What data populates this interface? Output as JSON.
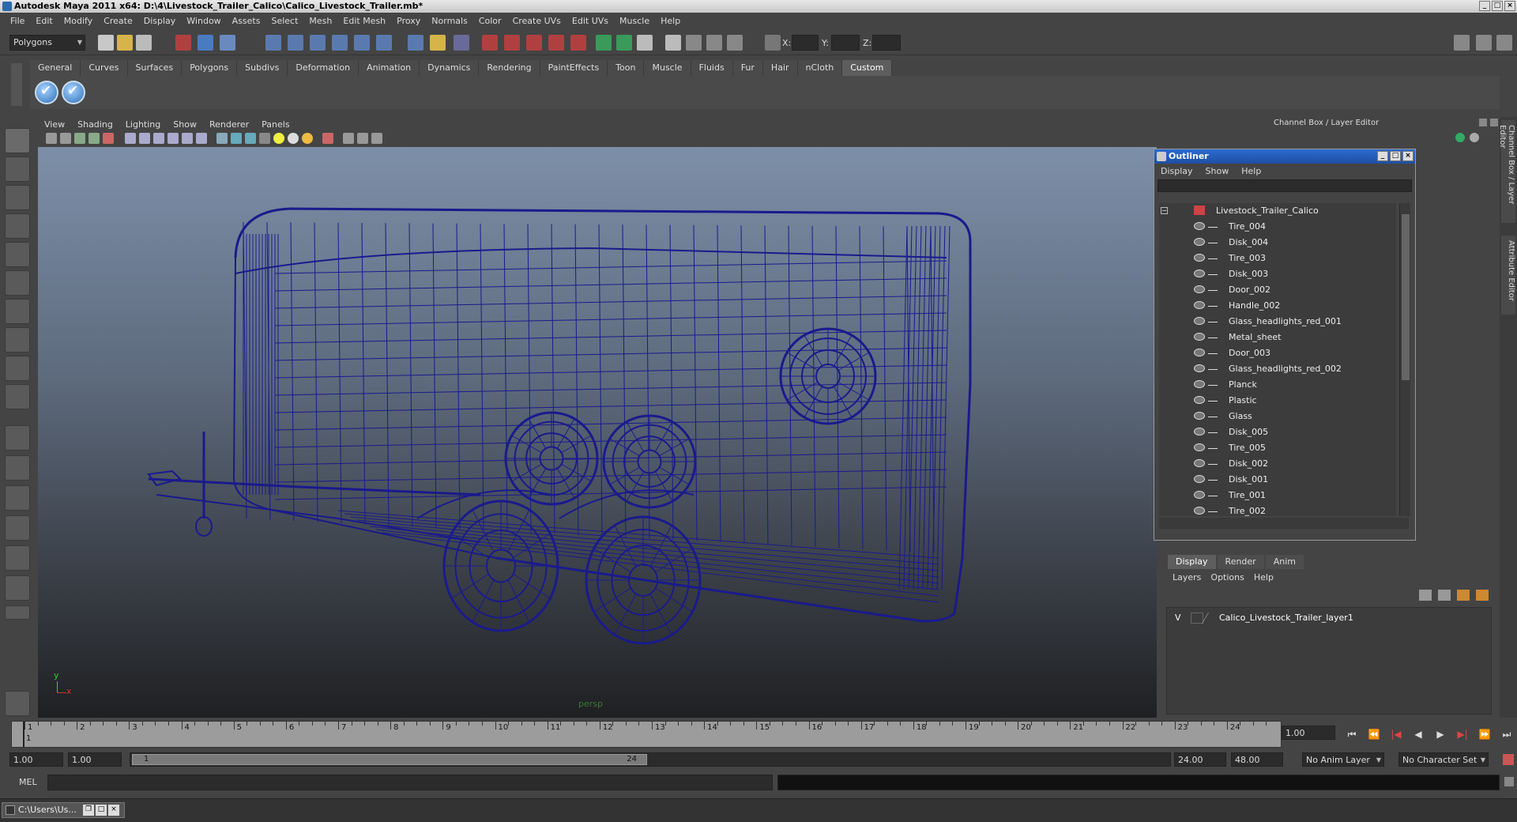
{
  "title": "Autodesk Maya 2011 x64: D:\\4\\Livestock_Trailer_Calico\\Calico_Livestock_Trailer.mb*",
  "menus": [
    "File",
    "Edit",
    "Modify",
    "Create",
    "Display",
    "Window",
    "Assets",
    "Select",
    "Mesh",
    "Edit Mesh",
    "Proxy",
    "Normals",
    "Color",
    "Create UVs",
    "Edit UVs",
    "Muscle",
    "Help"
  ],
  "status": {
    "mode": "Polygons",
    "x_label": "X:",
    "y_label": "Y:",
    "z_label": "Z:"
  },
  "shelf_tabs": [
    "General",
    "Curves",
    "Surfaces",
    "Polygons",
    "Subdivs",
    "Deformation",
    "Animation",
    "Dynamics",
    "Rendering",
    "PaintEffects",
    "Toon",
    "Muscle",
    "Fluids",
    "Fur",
    "Hair",
    "nCloth",
    "Custom"
  ],
  "shelf_active": "Custom",
  "viewport": {
    "menus": [
      "View",
      "Shading",
      "Lighting",
      "Show",
      "Renderer",
      "Panels"
    ],
    "camera": "persp",
    "axis_y": "y",
    "axis_x": "x"
  },
  "channel_box_title": "Channel Box / Layer Editor",
  "outliner": {
    "title": "Outliner",
    "menus": [
      "Display",
      "Show",
      "Help"
    ],
    "root": "Livestock_Trailer_Calico",
    "items": [
      "Tire_004",
      "Disk_004",
      "Tire_003",
      "Disk_003",
      "Door_002",
      "Handle_002",
      "Glass_headlights_red_001",
      "Metal_sheet",
      "Door_003",
      "Glass_headlights_red_002",
      "Planck",
      "Plastic",
      "Glass",
      "Disk_005",
      "Tire_005",
      "Disk_002",
      "Disk_001",
      "Tire_001",
      "Tire_002"
    ]
  },
  "layer_editor": {
    "tabs": [
      "Display",
      "Render",
      "Anim"
    ],
    "active": "Display",
    "menus": [
      "Layers",
      "Options",
      "Help"
    ],
    "layer_visible": "V",
    "layer_name": "Calico_Livestock_Trailer_layer1"
  },
  "side_tabs": [
    "Channel Box / Layer Editor",
    "Attribute Editor"
  ],
  "timeline": {
    "ticks": [
      "1",
      "2",
      "3",
      "4",
      "5",
      "6",
      "7",
      "8",
      "9",
      "10",
      "11",
      "12",
      "13",
      "14",
      "15",
      "16",
      "17",
      "18",
      "19",
      "20",
      "21",
      "22",
      "23",
      "24"
    ],
    "current_marker": "1",
    "current_frame": "1.00"
  },
  "range": {
    "start": "1.00",
    "start2": "1.00",
    "slider_start": "1",
    "slider_end": "24",
    "end": "24.00",
    "end2": "48.00",
    "anim_layer": "No Anim Layer",
    "char_set": "No Character Set"
  },
  "cmd": {
    "label": "MEL"
  },
  "taskbar": {
    "item": "C:\\Users\\Us..."
  },
  "wire_color": "#1a1a8c"
}
